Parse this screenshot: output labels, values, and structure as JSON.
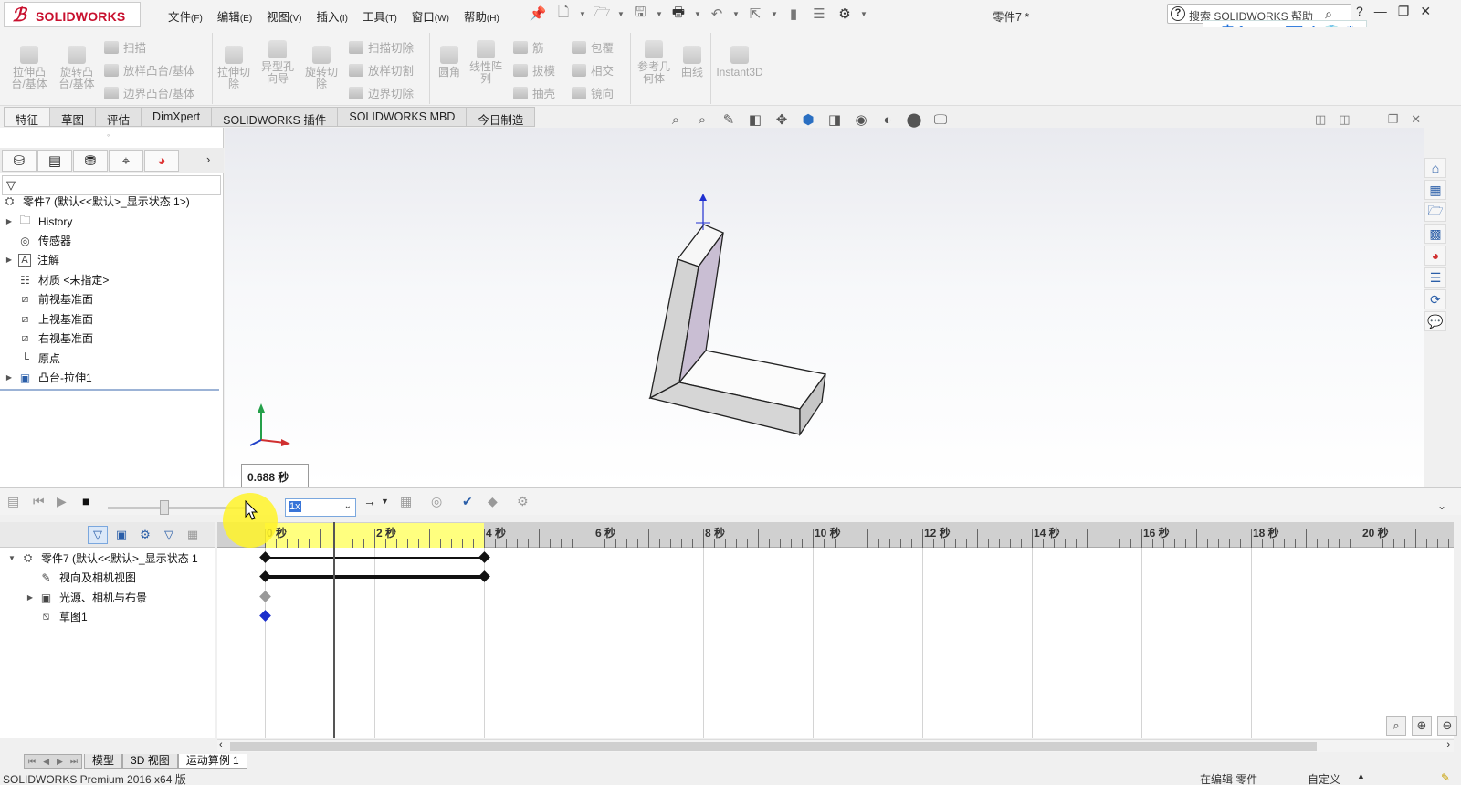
{
  "app": {
    "brand": "SOLIDWORKS",
    "document_title": "零件7 *"
  },
  "menu": [
    {
      "label": "文件",
      "key": "(F)"
    },
    {
      "label": "编辑",
      "key": "(E)"
    },
    {
      "label": "视图",
      "key": "(V)"
    },
    {
      "label": "插入",
      "key": "(I)"
    },
    {
      "label": "工具",
      "key": "(T)"
    },
    {
      "label": "窗口",
      "key": "(W)"
    },
    {
      "label": "帮助",
      "key": "(H)"
    }
  ],
  "search": {
    "placeholder": "搜索 SOLIDWORKS 帮助"
  },
  "ime_bar": {
    "lang": "中"
  },
  "command_manager": {
    "big_buttons": [
      "拉伸凸台/基体",
      "旋转凸台/基体",
      "拉伸切除",
      "异型孔向导",
      "旋转切除",
      "圆角",
      "线性阵列",
      "参考几何体",
      "曲线",
      "Instant3D"
    ],
    "small_col1": [
      "扫描",
      "放样凸台/基体",
      "边界凸台/基体"
    ],
    "small_col2": [
      "扫描切除",
      "放样切割",
      "边界切除"
    ],
    "small_col3": [
      "筋",
      "拔模",
      "抽壳"
    ],
    "small_col4": [
      "包覆",
      "相交",
      "镜向"
    ]
  },
  "tabs": [
    "特征",
    "草图",
    "评估",
    "DimXpert",
    "SOLIDWORKS 插件",
    "SOLIDWORKS MBD",
    "今日制造"
  ],
  "feature_tree": {
    "root": "零件7 (默认<<默认>_显示状态 1>)",
    "items": [
      {
        "label": "History",
        "expandable": true
      },
      {
        "label": "传感器",
        "expandable": false
      },
      {
        "label": "注解",
        "expandable": true
      },
      {
        "label": "材质 <未指定>",
        "expandable": false
      },
      {
        "label": "前视基准面",
        "expandable": false
      },
      {
        "label": "上视基准面",
        "expandable": false
      },
      {
        "label": "右视基准面",
        "expandable": false
      },
      {
        "label": "原点",
        "expandable": false
      },
      {
        "label": "凸台-拉伸1",
        "expandable": true
      }
    ]
  },
  "viewport": {
    "time_tooltip": "0.688 秒"
  },
  "motion_study": {
    "playback_speed": "1x",
    "tree": {
      "root": "零件7 (默认<<默认>_显示状态 1",
      "items": [
        "视向及相机视图",
        "光源、相机与布景",
        "草图1"
      ]
    },
    "ruler_labels": [
      "0 秒",
      "2 秒",
      "4 秒",
      "6 秒",
      "8 秒",
      "10 秒",
      "12 秒",
      "14 秒",
      "16 秒",
      "18 秒",
      "20 秒"
    ],
    "current_time_seconds": 1.25,
    "highlight_end_seconds": 4,
    "colors": {
      "highlight": "#ffff7f",
      "key_blue": "#1a2ecc"
    }
  },
  "bottom_tabs": [
    "模型",
    "3D 视图",
    "运动算例 1"
  ],
  "status": {
    "product": "SOLIDWORKS Premium 2016 x64 版",
    "mode": "在编辑 零件",
    "custom": "自定义"
  },
  "colors": {
    "brand_red": "#c8102e",
    "accent_blue": "#1e6fd9"
  }
}
